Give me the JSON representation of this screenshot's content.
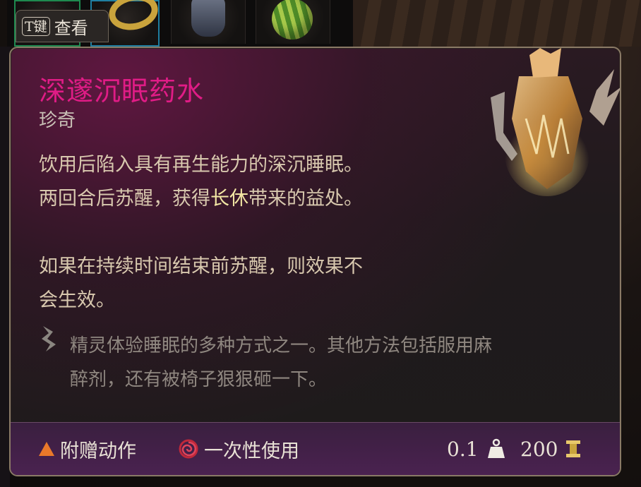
{
  "hint": {
    "key": "T键",
    "label": "查看"
  },
  "item": {
    "name": "深邃沉眠药水",
    "rarity": "珍奇",
    "description": {
      "line1": "饮用后陷入具有再生能力的深沉睡眠。",
      "line2_pre": "两回合后苏醒，获得",
      "line2_highlight": "长休",
      "line2_post": "带来的益处。",
      "line3": "如果在持续时间结束前苏醒，则效果不",
      "line4": "会生效。"
    },
    "flavor": {
      "line1": "精灵体验睡眠的多种方式之一。其他方法包括服用麻",
      "line2": "醉剂，还有被椅子狠狠砸一下。"
    }
  },
  "footer": {
    "action_type": "附赠动作",
    "usage": "一次性使用",
    "weight": "0.1",
    "value": "200"
  },
  "colors": {
    "title": "#e01c86",
    "highlight": "#f3e7a4",
    "body_text": "#d8c8ae",
    "flavor_text": "#8f8780",
    "footer_bg": "#4a2250"
  },
  "icons": [
    "weapon-slot-icon",
    "ring-item-icon",
    "armor-item-icon",
    "watermelon-item-icon",
    "potion-image",
    "quill-icon",
    "bonus-action-triangle-icon",
    "single-use-spiral-icon",
    "weight-icon",
    "gold-coin-icon"
  ]
}
